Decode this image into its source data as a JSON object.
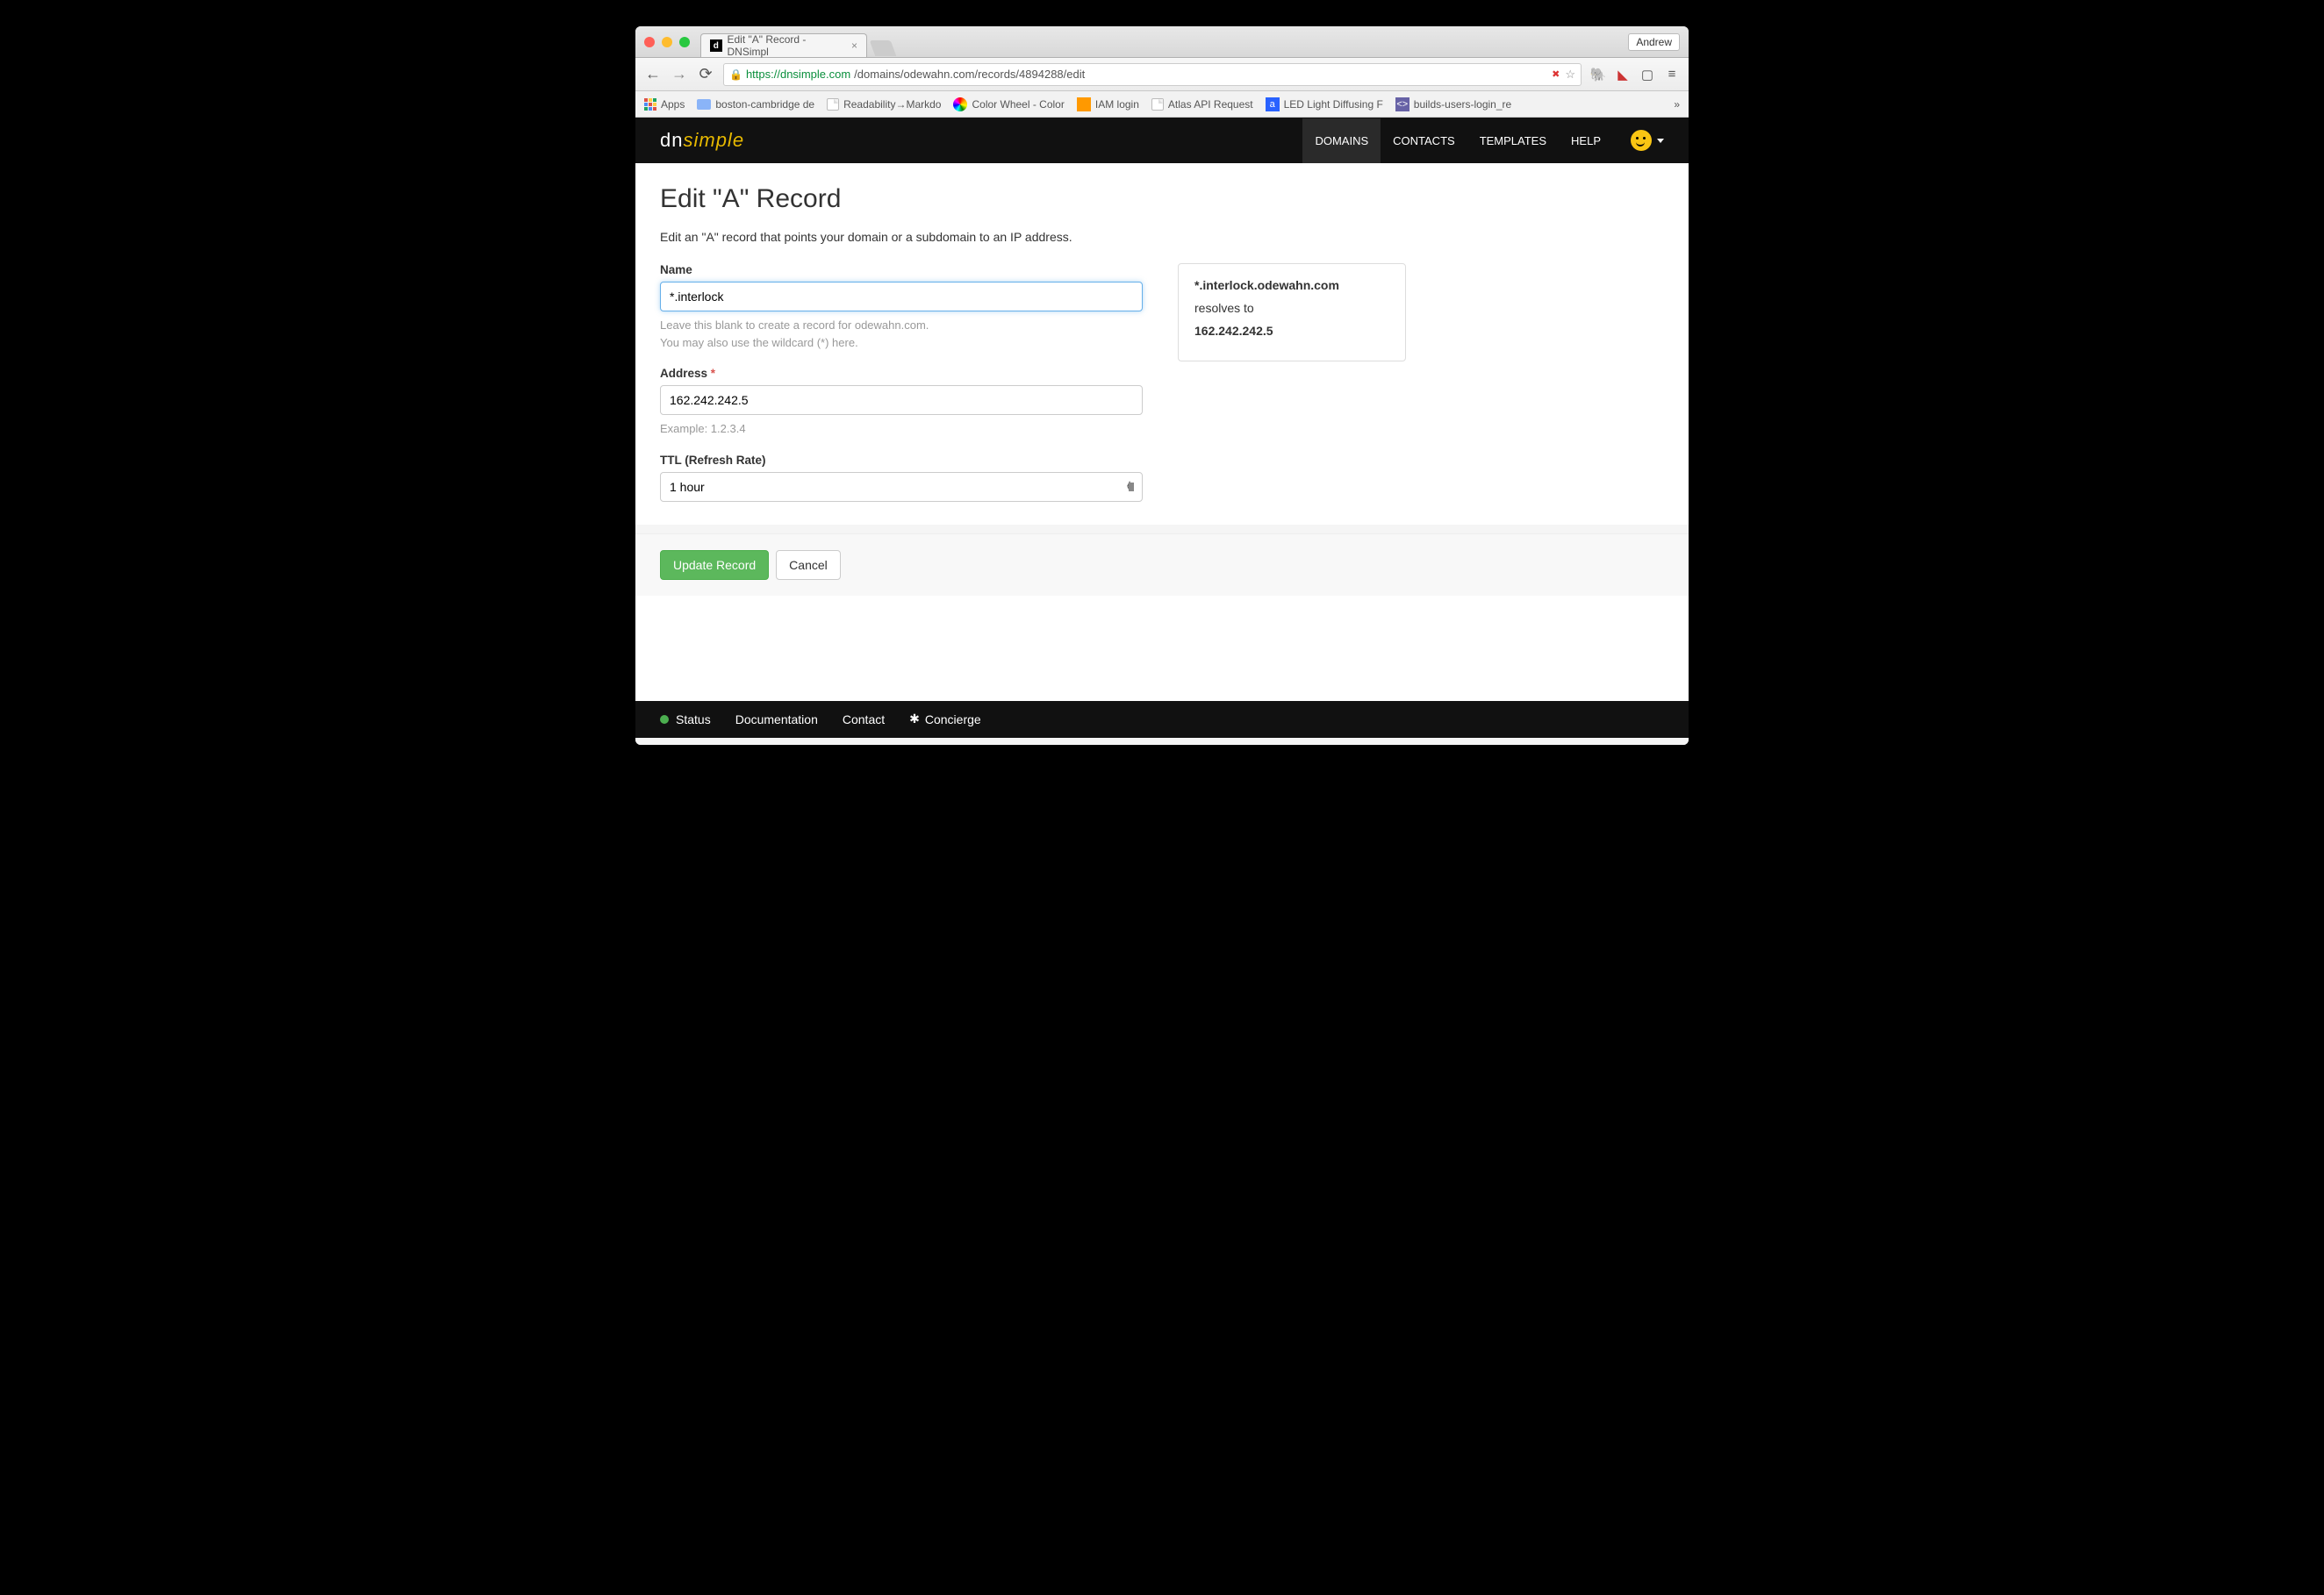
{
  "browser": {
    "profile": "Andrew",
    "tab_title": "Edit \"A\" Record - DNSimpl",
    "url_host": "https://dnsimple.com",
    "url_path": "/domains/odewahn.com/records/4894288/edit",
    "bookmarks": {
      "apps": "Apps",
      "items": [
        "boston-cambridge de",
        "Readability→Markdo",
        "Color Wheel - Color",
        "IAM login",
        "Atlas API Request",
        "LED Light Diffusing F",
        "builds-users-login_re"
      ]
    }
  },
  "header": {
    "logo_dn": "dn",
    "logo_simple": "simple",
    "nav": {
      "domains": "DOMAINS",
      "contacts": "CONTACTS",
      "templates": "TEMPLATES",
      "help": "HELP"
    }
  },
  "page": {
    "title": "Edit \"A\" Record",
    "subtitle": "Edit an \"A\" record that points your domain or a subdomain to an IP address.",
    "form": {
      "name_label": "Name",
      "name_value": "*.interlock",
      "name_help1": "Leave this blank to create a record for odewahn.com.",
      "name_help2": "You may also use the wildcard (*) here.",
      "address_label": "Address",
      "address_value": "162.242.242.5",
      "address_help": "Example: 1.2.3.4",
      "ttl_label": "TTL (Refresh Rate)",
      "ttl_value": "1 hour"
    },
    "preview": {
      "hostname": "*.interlock.odewahn.com",
      "resolves_label": "resolves to",
      "ip": "162.242.242.5"
    },
    "actions": {
      "update": "Update Record",
      "cancel": "Cancel"
    }
  },
  "footer": {
    "status": "Status",
    "documentation": "Documentation",
    "contact": "Contact",
    "concierge": "Concierge"
  }
}
